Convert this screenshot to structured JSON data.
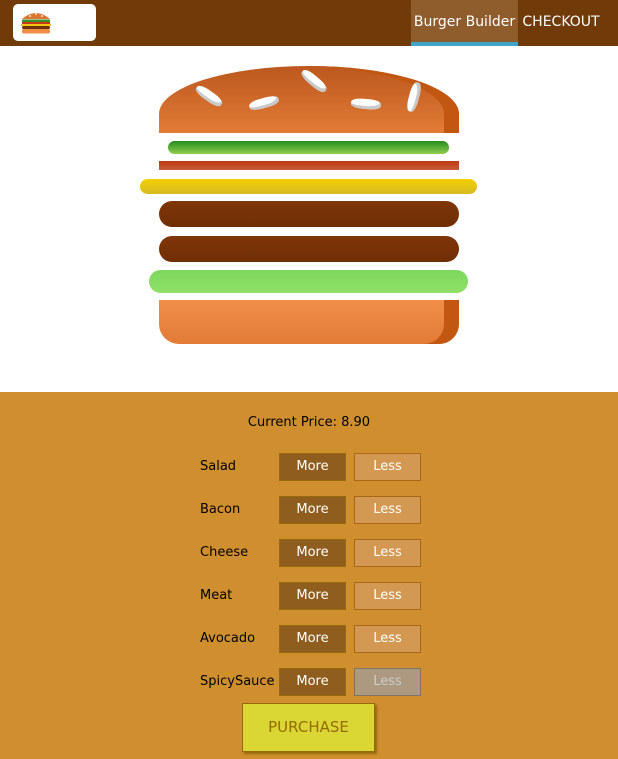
{
  "toolbar": {
    "logo_icon": "burger-logo-icon",
    "nav": [
      {
        "label": "Burger Builder",
        "active": true
      },
      {
        "label": "CHECKOUT",
        "active": false
      }
    ],
    "colors": {
      "bar": "#703B09",
      "active_bg": "#8F5C2C",
      "active_underline": "#40A4C8"
    }
  },
  "burger": {
    "ingredients": [
      "bread-top",
      "salad",
      "bacon",
      "cheese",
      "meat",
      "meat",
      "avocado",
      "bread-bottom"
    ]
  },
  "build_controls": {
    "price_label": "Current Price: 8.90",
    "more_label": "More",
    "less_label": "Less",
    "items": [
      {
        "label": "Salad",
        "less_disabled": false
      },
      {
        "label": "Bacon",
        "less_disabled": false
      },
      {
        "label": "Cheese",
        "less_disabled": false
      },
      {
        "label": "Meat",
        "less_disabled": false
      },
      {
        "label": "Avocado",
        "less_disabled": false
      },
      {
        "label": "SpicySauce",
        "less_disabled": true
      }
    ],
    "purchase_label": "PURCHASE",
    "colors": {
      "panel": "#CF8F2E",
      "more": "#8F5E1E",
      "less": "#D39952",
      "purchase": "#DAD735"
    }
  }
}
